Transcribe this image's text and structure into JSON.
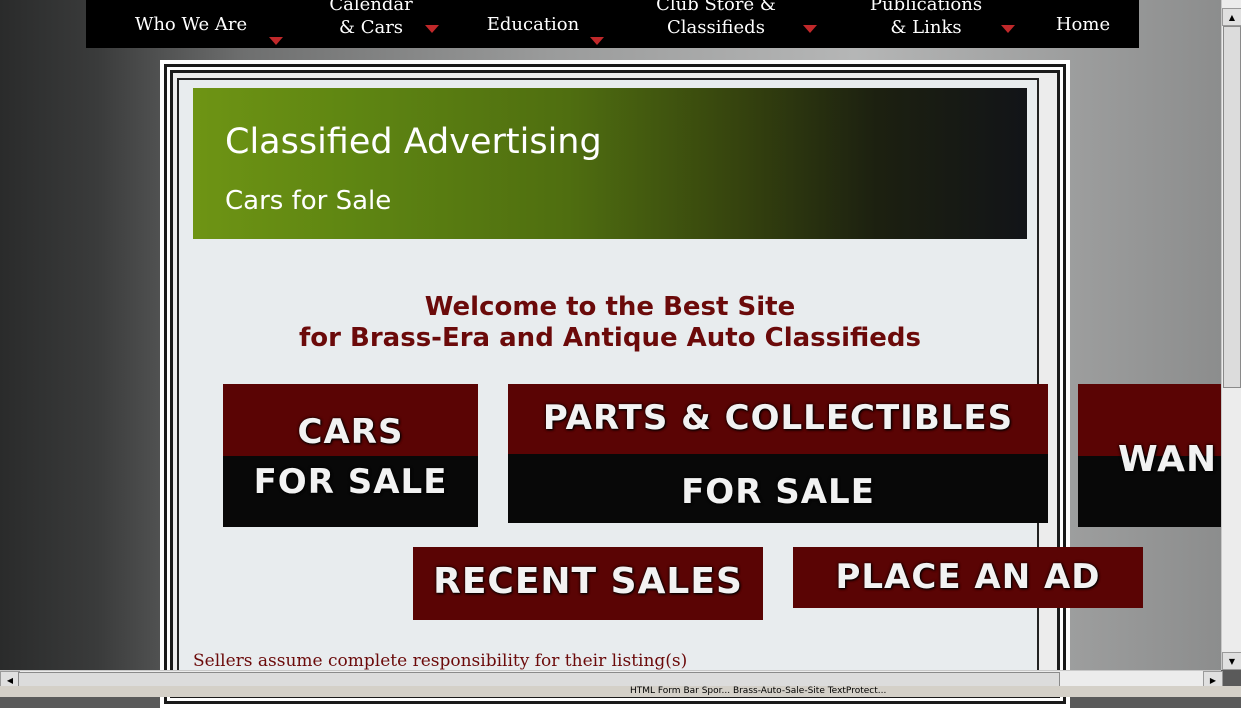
{
  "nav": {
    "items": [
      {
        "label_1": "Who We Are",
        "label_2": ""
      },
      {
        "label_1": "Calendar",
        "label_2": "& Cars"
      },
      {
        "label_1": "Education",
        "label_2": ""
      },
      {
        "label_1": "Club Store &",
        "label_2": "Classifieds"
      },
      {
        "label_1": "Publications",
        "label_2": "& Links"
      },
      {
        "label_1": "Home",
        "label_2": ""
      }
    ]
  },
  "banner": {
    "title": "Classified Advertising",
    "subtitle": "Cars for Sale"
  },
  "welcome": {
    "line1": "Welcome to the Best Site",
    "line2": "for Brass-Era and Antique Auto Classifieds"
  },
  "buttons": {
    "cars_top": "CARS",
    "cars_bottom": "FOR SALE",
    "parts_top": "PARTS & COLLECTIBLES",
    "parts_bottom": "FOR SALE",
    "wanted": "WAN",
    "recent_sales": "RECENT SALES",
    "place_ad": "PLACE AN AD"
  },
  "footer": {
    "note": "Sellers assume complete responsibility for their listing(s)"
  },
  "status": {
    "text": "HTML Form  Bar Spor...   Brass-Auto-Sale-Site   TextProtect..."
  },
  "colors": {
    "accent_red": "#5a0404",
    "text_maroon": "#6b0a0a",
    "banner_green": "#6e9414",
    "nav_arrow": "#c0282a"
  }
}
